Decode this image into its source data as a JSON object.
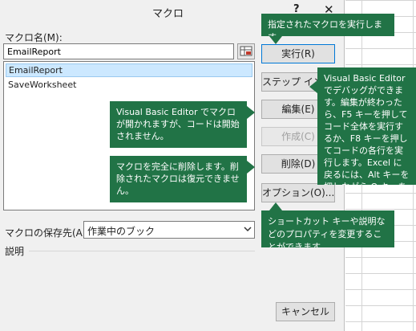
{
  "dialog": {
    "title": "マクロ",
    "help_label": "?",
    "close_label": "✕",
    "macro_name_label": "マクロ名(M):",
    "macro_name_value": "EmailReport",
    "macros": [
      "EmailReport",
      "SaveWorksheet"
    ],
    "store_label": "マクロの保存先(A):",
    "store_value": "作業中のブック",
    "description_label": "説明",
    "buttons": {
      "run": "実行(R)",
      "step_into": "ステップ イン(S)",
      "edit": "編集(E)",
      "create": "作成(C)",
      "delete": "削除(D)",
      "options": "オプション(O)..."
    },
    "cancel_label": "キャンセル"
  },
  "callouts": {
    "run": "指定されたマクロを実行します。",
    "edit": "Visual Basic Editor でマクロが開かれますが、コードは開始されません。",
    "delete": "マクロを完全に削除します。削除されたマクロは復元できません。",
    "step": "Visual Basic Editor でデバッグができます。編集が終わったら、F5 キーを押してコード全体を実行するか、F8 キーを押してコードの各行を実行します。Excel に戻るには、Alt キーを押しながら Q キーを押します。",
    "options": "ショートカット キーや説明などのプロパティを変更することができます。"
  },
  "colors": {
    "callout_bg": "#217346",
    "selection": "#cce8ff",
    "dialog_bg": "#f0f0f0"
  }
}
